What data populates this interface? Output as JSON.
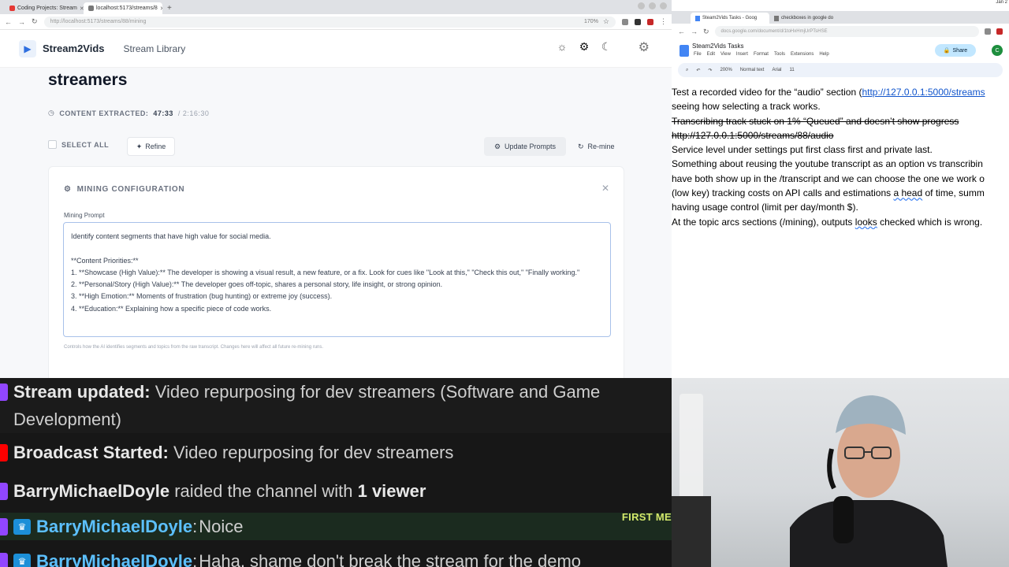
{
  "left_browser": {
    "tabs": [
      {
        "label": "Coding Projects: Stream",
        "favicon_color": "#e53935"
      },
      {
        "label": "localhost:5173/streams/8",
        "favicon_color": "#777777"
      }
    ],
    "url": "http://localhost:5173/streams/88/mining",
    "zoom": "170%"
  },
  "app": {
    "brand": "Stream2Vids",
    "nav_library": "Stream Library",
    "page_title": "streamers",
    "content_extracted_label": "CONTENT EXTRACTED:",
    "extracted_time": "47:33",
    "total_time": "/ 2:16:30",
    "select_all": "SELECT ALL",
    "refine": "Refine",
    "update_prompts": "Update Prompts",
    "remine": "Re-mine",
    "card_title": "MINING CONFIGURATION",
    "mining_prompt_label": "Mining Prompt",
    "prompt_text": "Identify content segments that have high value for social media.\n\n**Content Priorities:**\n1. **Showcase (High Value):** The developer is showing a visual result, a new feature, or a fix. Look for cues like \"Look at this,\" \"Check this out,\" \"Finally working.\"\n2. **Personal/Story (High Value):** The developer goes off-topic, shares a personal story, life insight, or strong opinion.\n3. **High Emotion:** Moments of frustration (bug hunting) or extreme joy (success).\n4. **Education:** Explaining how a specific piece of code works.",
    "help_text": "Controls how the AI identifies segments and topics from the raw transcript. Changes here will affect all future re-mining runs.",
    "accent": "#2f6fe0"
  },
  "right_browser": {
    "clock": "Jan 2",
    "tabs": [
      {
        "label": "Steam2Vids Tasks - Goog"
      },
      {
        "label": "checkboxes in google do"
      }
    ],
    "url": "docs.google.com/document/d/1toHxHmjUrPTsHSE",
    "doc_title": "Steam2Vids Tasks",
    "menu": [
      "File",
      "Edit",
      "View",
      "Insert",
      "Format",
      "Tools",
      "Extensions",
      "Help"
    ],
    "share": "Share",
    "avatar_letter": "C",
    "toolbar": {
      "zoom": "200%",
      "style": "Normal text",
      "font": "Arial",
      "size": "11"
    }
  },
  "doc": {
    "line1a": "Test a recorded video for the “audio” section (",
    "line1_link": "http://127.0.0.1:5000/streams",
    "line2": "seeing how selecting a track works.",
    "line3": "Transcribing track stuck on 1% “Queued” and doesn’t show progress",
    "line4": "http://127.0.0.1:5000/streams/88/audio",
    "line5": "Service level under settings put first class first and private last.",
    "line6": "Something about reusing the youtube transcript as an option vs transcribin",
    "line7": "have both show up in the /transcript and we can choose the one we work o",
    "line8a": "(low key) tracking costs on API calls and estimations ",
    "line8_sq": "a head",
    "line8b": " of time, summ",
    "line9": "having usage control (limit per day/month $).",
    "line10a": "At the topic arcs sections (/mining), outputs ",
    "line10_sq": "looks",
    "line10b": " checked which is wrong."
  },
  "chat": {
    "m1_user": "Stream updated:",
    "m1_text": " Video repurposing for dev streamers (Software and Game Development)",
    "m2_user": "Broadcast Started:",
    "m2_text": " Video repurposing for dev streamers",
    "m3_user": "BarryMichaelDoyle",
    "m3_text": " raided the channel with ",
    "m3_bold": "1 viewer",
    "m4_user": "BarryMichaelDoyle",
    "m4_text": "Noice",
    "m4_tag": "FIRST ME",
    "m5_user": "BarryMichaelDoyle",
    "m5_text": "Haha, shame don't break the stream for the demo",
    "badge_twitch": "#9146ff",
    "badge_youtube": "#ff0000"
  }
}
